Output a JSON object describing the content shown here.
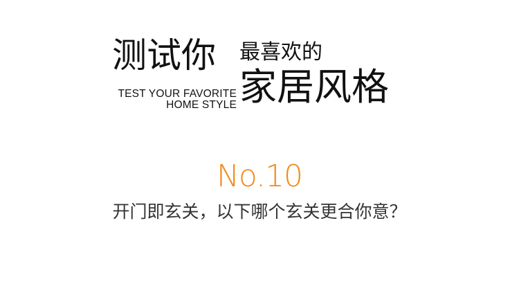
{
  "header": {
    "title_part1": "测试你",
    "title_part2": "最喜欢的",
    "title_part3": "家居风格",
    "subtitle_line1": "TEST YOUR FAVORITE",
    "subtitle_line2": "HOME STYLE"
  },
  "question": {
    "number": "No.10",
    "text": "开门即玄关，以下哪个玄关更合你意？"
  },
  "colors": {
    "accent": "#f28a1b",
    "title": "#111111",
    "question": "#333333"
  }
}
